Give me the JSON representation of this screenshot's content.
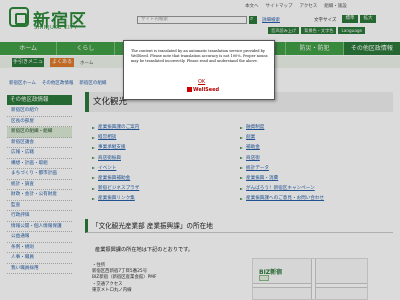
{
  "header": {
    "logo_main": "新宿区",
    "logo_sub": "SHINJUKU CITY",
    "search_placeholder": "サイト内検索",
    "detail_search": "詳細検索",
    "top_links": [
      "本文へ",
      "サイトマップ",
      "アクセス",
      "組織・施設"
    ],
    "fontsize_label": "文字サイズ",
    "fontsize_buttons": [
      "標準",
      "拡大"
    ],
    "lang_buttons": [
      "音声読み上げ",
      "背景色・文字色",
      "Language"
    ]
  },
  "nav": {
    "items": [
      "ホーム",
      "くらし",
      "",
      "",
      "",
      "防災・防犯",
      "その他区政情報"
    ]
  },
  "subnav": {
    "button1": "手引きメニュー",
    "button2": "よくある",
    "text": "ホーム"
  },
  "breadcrumb": [
    "新宿区ホーム",
    "その他区政情報",
    "新宿区の組織"
  ],
  "sidebar": {
    "title": "その他区政情報",
    "items": [
      "新宿区の紹介",
      "区長の部屋",
      "新宿区の組織・組織",
      "新宿区議会",
      "広報・広聴",
      "構想・計画・取組",
      "まちづくり・都市計画",
      "統計・調査",
      "財政・会計・公有財産",
      "監査",
      "行政評価",
      "情報公開・個人情報保護",
      "公益通報",
      "条例・規則",
      "人事・職員",
      "我い職員採用"
    ]
  },
  "main": {
    "title": "文化観光",
    "links_left": [
      "産業振興課のご案内",
      "経営相談",
      "事業承継支援",
      "商店街振興",
      "イベント",
      "産業振興補助金",
      "新宿ビジネスプラザ",
      "産業振興リンク集"
    ],
    "links_right": [
      "融資制度",
      "創業",
      "補助金",
      "商店街",
      "統計データ",
      "産業振興・消費",
      "がんばろう！新宿区キャンペーン",
      "産業振興課へのご意見・お問い合わせ"
    ],
    "section_heading": "「文化観光産業部 産業振興課」の所在地",
    "body_text": "産業振興課の所在地は下記のとおりです。",
    "address_lines": [
      "・住所",
      "新宿区西新宿7丁目5番25号",
      "BIZ新宿（新宿区産業会館）PMF",
      "・交通アクセス",
      "東京メトロ丸ノ内線"
    ],
    "map_label": "BIZ新宿"
  },
  "modal": {
    "text": "The content is translated by an automatic translation service provided by WellSeed. Please note that translation accuracy is not 100%. Proper nouns may be translated incorrectly. Please read and understand the above.",
    "ok": "OK",
    "logo": "WellSeed"
  }
}
